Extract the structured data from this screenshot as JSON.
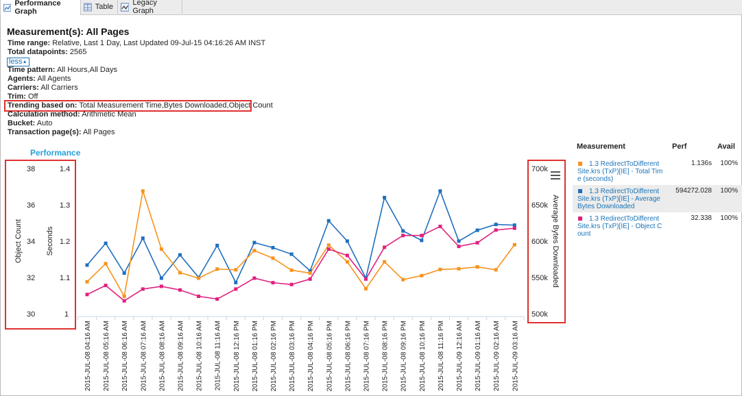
{
  "tabs": [
    {
      "label": "Performance Graph",
      "icon": "performance-graph-icon",
      "active": true
    },
    {
      "label": "Table",
      "icon": "table-icon",
      "active": false
    },
    {
      "label": "Legacy Graph",
      "icon": "legacy-graph-icon",
      "active": false
    }
  ],
  "header": {
    "title": "Measurement(s): All Pages",
    "time_range_label": "Time range:",
    "time_range_value": "Relative, Last 1 Day, Last Updated 09-Jul-15 04:16:26 AM INST",
    "datapoints_label": "Total datapoints:",
    "datapoints_value": "2565",
    "less_link": "less",
    "time_pattern_label": "Time pattern:",
    "time_pattern_value": "All Hours,All Days",
    "agents_label": "Agents:",
    "agents_value": "All Agents",
    "carriers_label": "Carriers:",
    "carriers_value": "All Carriers",
    "trim_label": "Trim:",
    "trim_value": "Off",
    "trending_label": "Trending based on:",
    "trending_value": "Total Measurement Time,Bytes Downloaded,Object Count",
    "calc_label": "Calculation method:",
    "calc_value": "Arithmetic Mean",
    "bucket_label": "Bucket:",
    "bucket_value": "Auto",
    "transaction_label": "Transaction page(s):",
    "transaction_value": "All Pages"
  },
  "colors": {
    "blue": "#1f6fbf",
    "orange": "#f7931e",
    "magenta": "#e0217e",
    "highlight_red": "#e0302e",
    "link_blue": "#1a74b8",
    "title_blue": "#29a0d8"
  },
  "chart_data": {
    "type": "line",
    "title": "Performance",
    "x": [
      "2015-JUL-08 04:16 AM",
      "2015-JUL-08 05:16 AM",
      "2015-JUL-08 06:16 AM",
      "2015-JUL-08 07:16 AM",
      "2015-JUL-08 08:16 AM",
      "2015-JUL-08 09:16 AM",
      "2015-JUL-08 10:16 AM",
      "2015-JUL-08 11:16 AM",
      "2015-JUL-08 12:16 PM",
      "2015-JUL-08 01:16 PM",
      "2015-JUL-08 02:16 PM",
      "2015-JUL-08 03:16 PM",
      "2015-JUL-08 04:16 PM",
      "2015-JUL-08 05:16 PM",
      "2015-JUL-08 06:16 PM",
      "2015-JUL-08 07:16 PM",
      "2015-JUL-08 08:16 PM",
      "2015-JUL-08 09:16 PM",
      "2015-JUL-08 10:16 PM",
      "2015-JUL-08 11:16 PM",
      "2015-JUL-09 12:16 AM",
      "2015-JUL-09 01:16 AM",
      "2015-JUL-09 02:16 AM",
      "2015-JUL-09 03:16 AM"
    ],
    "axes": {
      "object_count": {
        "label": "Object Count",
        "range": [
          30,
          38
        ],
        "ticks": [
          "30",
          "32",
          "34",
          "36",
          "38"
        ]
      },
      "seconds": {
        "label": "Seconds",
        "range": [
          1,
          1.4
        ],
        "ticks": [
          "1",
          "1.1",
          "1.2",
          "1.3",
          "1.4"
        ]
      },
      "bytes": {
        "label": "Average Bytes Downloaded",
        "range": [
          500000,
          700000
        ],
        "ticks": [
          "500k",
          "550k",
          "600k",
          "650k",
          "700k"
        ]
      }
    },
    "series": [
      {
        "name": "1.3 RedirectToDifferentSite.krs (TxP)[IE] - Average Bytes Downloaded",
        "axis": "bytes",
        "color": "#1f6fbf",
        "values": [
          568000,
          598000,
          557000,
          605000,
          550000,
          582000,
          551000,
          595000,
          544000,
          599000,
          592000,
          583000,
          560000,
          629000,
          601000,
          550000,
          661000,
          615000,
          602000,
          670000,
          601000,
          616000,
          624000,
          623000
        ]
      },
      {
        "name": "1.3 RedirectToDifferentSite.krs (TxP)[IE] - Total Time (seconds)",
        "axis": "seconds",
        "color": "#f7931e",
        "values": [
          1.09,
          1.14,
          1.05,
          1.34,
          1.18,
          1.115,
          1.1,
          1.125,
          1.123,
          1.176,
          1.155,
          1.122,
          1.114,
          1.191,
          1.145,
          1.071,
          1.145,
          1.096,
          1.107,
          1.124,
          1.126,
          1.131,
          1.123,
          1.192
        ]
      },
      {
        "name": "1.3 RedirectToDifferentSite.krs (TxP)[IE] - Object Count",
        "axis": "object_count",
        "color": "#e0217e",
        "values": [
          31.1,
          31.6,
          30.75,
          31.4,
          31.55,
          31.35,
          31.0,
          30.85,
          31.4,
          32.0,
          31.75,
          31.65,
          31.95,
          33.6,
          33.25,
          31.95,
          33.7,
          34.35,
          34.35,
          34.85,
          33.75,
          33.95,
          34.65,
          34.75
        ]
      }
    ],
    "grid": false,
    "legend": "right"
  },
  "legend": {
    "headers": {
      "measurement": "Measurement",
      "perf": "Perf",
      "avail": "Avail"
    },
    "rows": [
      {
        "name": "1.3 RedirectToDifferent Site.krs (TxP)[IE] - Total Tim e (seconds)",
        "perf": "1.136s",
        "avail": "100%",
        "color": "#f7931e"
      },
      {
        "name": "1.3 RedirectToDifferent Site.krs (TxP)[IE] - Average Bytes Downloaded",
        "perf": "594272.028",
        "avail": "100%",
        "color": "#1f6fbf"
      },
      {
        "name": "1.3 RedirectToDifferent Site.krs (TxP)[IE] - Object C ount",
        "perf": "32.338",
        "avail": "100%",
        "color": "#e0217e"
      }
    ]
  }
}
